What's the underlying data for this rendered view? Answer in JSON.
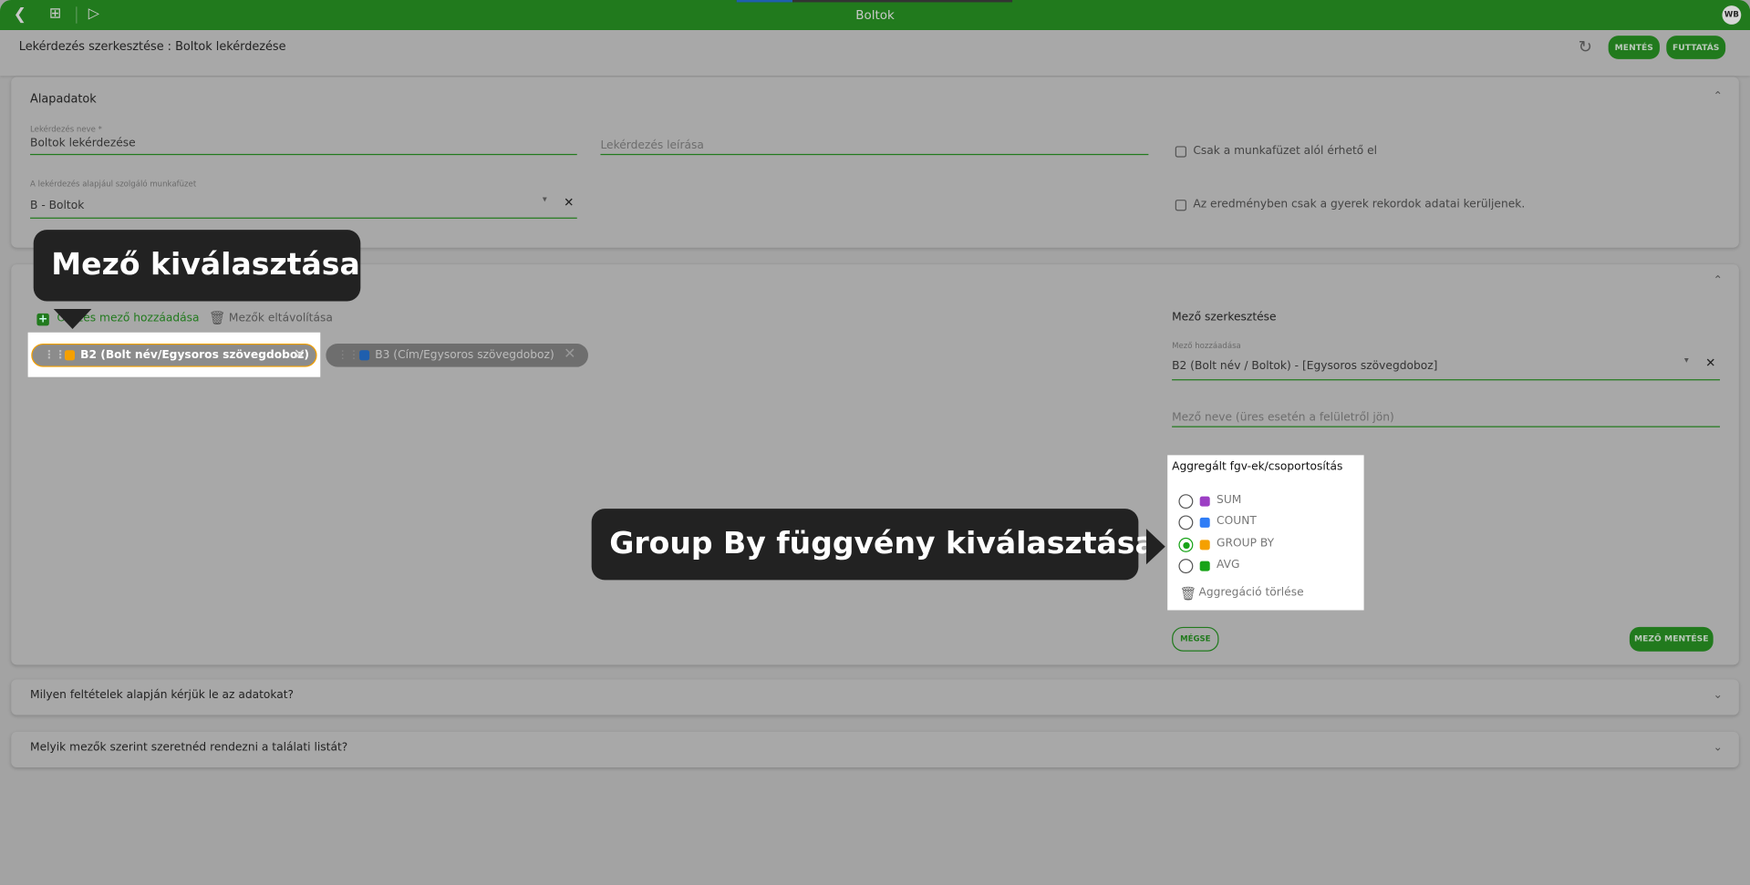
{
  "topbar": {
    "title": "Boltok",
    "avatar": "WB",
    "icons": [
      "chevron-left-icon",
      "grid-icon",
      "play-circle-icon"
    ]
  },
  "subheader": {
    "breadcrumb": "Lekérdezés szerkesztése : Boltok lekérdezése",
    "save_label": "MENTÉS",
    "run_label": "FUTTATÁS"
  },
  "basics": {
    "title": "Alapadatok",
    "name_label": "Lekérdezés neve *",
    "name_value": "Boltok lekérdezése",
    "description_placeholder": "Lekérdezés leírása",
    "workbook_label": "A lekérdezés alapjául szolgáló munkafüzet",
    "workbook_value": "B - Boltok",
    "checkbox1": "Csak a munkafüzet alól érhető el",
    "checkbox2": "Az eredményben csak a gyerek rekordok adatai kerüljenek."
  },
  "fields": {
    "add_all": "Összes mező hozzáadása",
    "remove": "Mezők eltávolítása",
    "chips": [
      {
        "label": "B2 (Bolt név/Egysoros szövegdoboz)",
        "color": "#f5a000",
        "selected": true
      },
      {
        "label": "B3 (Cím/Egysoros szövegdoboz)",
        "color": "#1f5fae",
        "selected": false
      }
    ],
    "edit": {
      "title": "Mező szerkesztése",
      "add_label": "Mező hozzáadása",
      "add_value": "B2 (Bolt név / Boltok) - [Egysoros szövegdoboz]",
      "name_placeholder": "Mező neve (üres esetén a felületről jön)",
      "agg_title": "Aggregált fgv-ek/csoportosítás",
      "options": [
        {
          "label": "SUM",
          "color": "#9c3fc4",
          "checked": false
        },
        {
          "label": "COUNT",
          "color": "#2f7df6",
          "checked": false
        },
        {
          "label": "GROUP BY",
          "color": "#f5a000",
          "checked": true
        },
        {
          "label": "AVG",
          "color": "#17a317",
          "checked": false
        }
      ],
      "clear_agg": "Aggregáció törlése",
      "cancel": "MÉGSE",
      "save": "MEZŐ MENTÉSE"
    }
  },
  "conditions": {
    "title": "Milyen feltételek alapján kérjük le az adatokat?"
  },
  "sorting": {
    "title": "Melyik mezők szerint szeretnéd rendezni a találati listát?"
  },
  "tooltips": {
    "field_select": "Mező kiválasztása",
    "groupby_select": "Group By függvény kiválasztása"
  },
  "colors": {
    "brand": "#217a1d",
    "overlay_bg": "#a3a3a3",
    "tooltip": "#222222"
  }
}
